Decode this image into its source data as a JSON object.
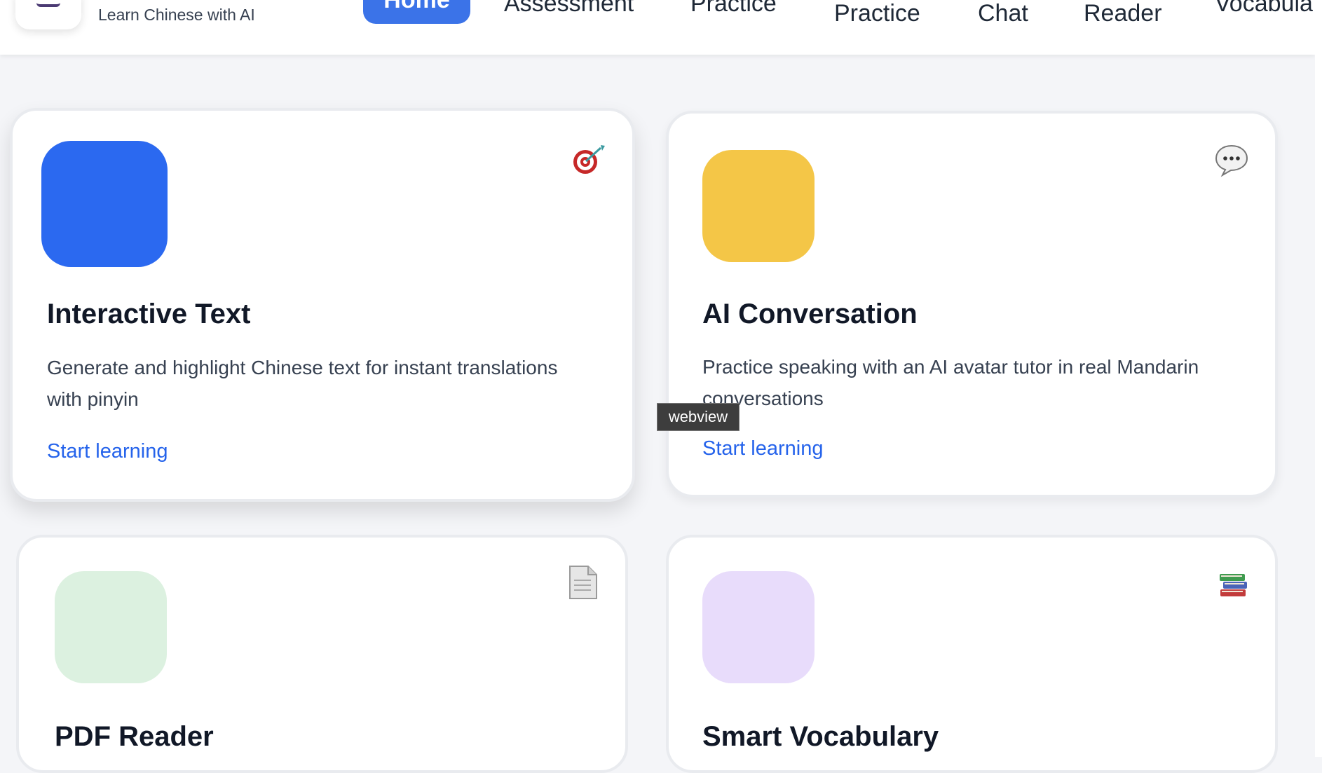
{
  "header": {
    "tagline": "Learn Chinese with AI",
    "nav": {
      "home": "Home",
      "assessment": "Assessment",
      "practice_top": "Practice",
      "practice": "Practice",
      "chat": "Chat",
      "reader": "Reader",
      "vocabulary": "Vocabula"
    }
  },
  "cards": [
    {
      "title": "Interactive Text",
      "description": "Generate and highlight Chinese text for instant translations with pinyin",
      "link": "Start learning",
      "icon": "target-icon",
      "accent": "#2b69f0"
    },
    {
      "title": "AI Conversation",
      "description": "Practice speaking with an AI avatar tutor in real Mandarin conversations",
      "link": "Start learning",
      "icon": "speech-bubble-icon",
      "accent": "#f4c647"
    },
    {
      "title": "PDF Reader",
      "icon": "document-icon",
      "accent": "#dcf1e0"
    },
    {
      "title": "Smart Vocabulary",
      "icon": "books-icon",
      "accent": "#e8dcfb"
    }
  ],
  "tooltip": "webview"
}
